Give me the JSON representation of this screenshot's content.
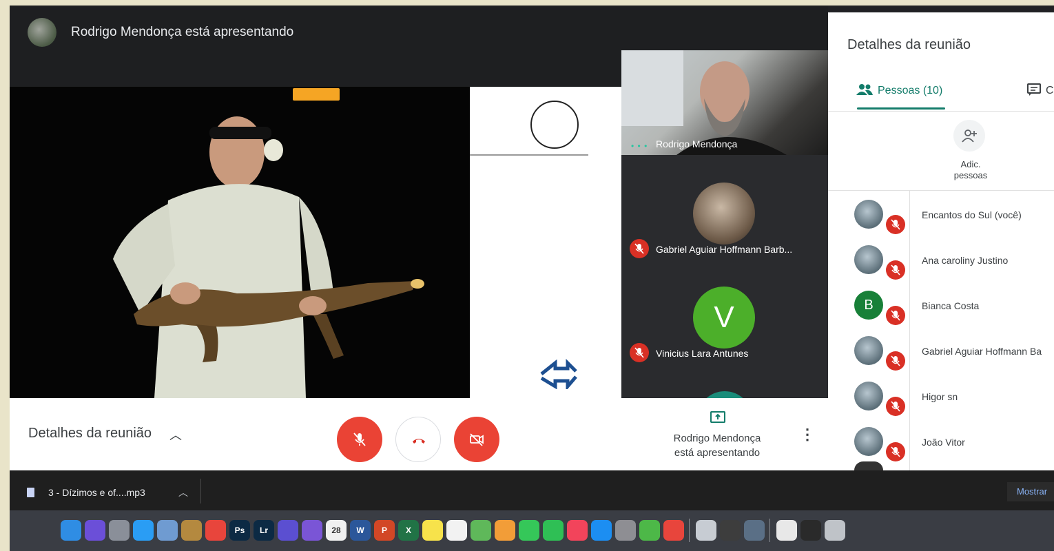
{
  "presenter_bar": {
    "text": "Rodrigo Mendonça está apresentando"
  },
  "tiles": [
    {
      "name": "Rodrigo Mendonça",
      "speaking": true
    },
    {
      "name": "Gabriel Aguiar Hoffmann Barb...",
      "muted": true
    },
    {
      "name": "Vinicius Lara Antunes",
      "avatar_letter": "V",
      "muted": true
    }
  ],
  "controls": {
    "details_label": "Detalhes da reunião",
    "presenting_text": [
      "Rodrigo Mendonça",
      "está apresentando"
    ]
  },
  "panel": {
    "title": "Detalhes da reunião",
    "tab_people": "Pessoas (10)",
    "tab_chat": "C",
    "add_people": [
      "Adic.",
      "pessoas"
    ],
    "people": [
      {
        "name": "Encantos do Sul (você)",
        "muted": true
      },
      {
        "name": "Ana caroliny Justino",
        "muted": true
      },
      {
        "name": "Bianca Costa",
        "avatar_letter": "B",
        "muted": true
      },
      {
        "name": "Gabriel Aguiar Hoffmann Ba",
        "muted": true
      },
      {
        "name": "Higor sn",
        "muted": true
      },
      {
        "name": "João Vitor",
        "muted": true
      }
    ]
  },
  "download_bar": {
    "file": "3 - Dízimos e of....mp3",
    "show_all": "Mostrar"
  },
  "dock": {
    "items": [
      {
        "icon": "finder-icon",
        "label": "",
        "color": "#2f8de4"
      },
      {
        "icon": "siri-icon",
        "label": "",
        "color": "#6b4fd8"
      },
      {
        "icon": "launchpad-icon",
        "label": "",
        "color": "#8a8f99"
      },
      {
        "icon": "safari-icon",
        "label": "",
        "color": "#2a9df4"
      },
      {
        "icon": "preview-icon",
        "label": "",
        "color": "#6f9bd1"
      },
      {
        "icon": "notes-book-icon",
        "label": "",
        "color": "#b4893f"
      },
      {
        "icon": "chrome-icon",
        "label": "",
        "color": "#e8453c"
      },
      {
        "icon": "photoshop-icon",
        "label": "Ps",
        "color": "#0c2a44"
      },
      {
        "icon": "lightroom-icon",
        "label": "Lr",
        "color": "#0c2a44"
      },
      {
        "icon": "imovie-icon",
        "label": "",
        "color": "#5b4fd1"
      },
      {
        "icon": "star-icon",
        "label": "",
        "color": "#7a55d6"
      },
      {
        "icon": "calendar-icon",
        "label": "28",
        "color": "#f0f0f0"
      },
      {
        "icon": "word-icon",
        "label": "W",
        "color": "#2b579a"
      },
      {
        "icon": "powerpoint-icon",
        "label": "P",
        "color": "#d24726"
      },
      {
        "icon": "excel-icon",
        "label": "X",
        "color": "#217346"
      },
      {
        "icon": "stickies-icon",
        "label": "",
        "color": "#f7e24b"
      },
      {
        "icon": "reminders-icon",
        "label": "",
        "color": "#f2f2f2"
      },
      {
        "icon": "maps-icon",
        "label": "",
        "color": "#5fb85a"
      },
      {
        "icon": "photos-icon",
        "label": "",
        "color": "#f29d38"
      },
      {
        "icon": "messages-icon",
        "label": "",
        "color": "#35c759"
      },
      {
        "icon": "facetime-icon",
        "label": "",
        "color": "#2fbf55"
      },
      {
        "icon": "music-icon",
        "label": "",
        "color": "#f2445b"
      },
      {
        "icon": "appstore-icon",
        "label": "",
        "color": "#1c8ef2"
      },
      {
        "icon": "settings-icon",
        "label": "",
        "color": "#8e8e93"
      },
      {
        "icon": "utorrent-icon",
        "label": "",
        "color": "#4db848"
      },
      {
        "icon": "anydesk-icon",
        "label": "",
        "color": "#e8453c"
      },
      {
        "icon": "mail-icon",
        "label": "",
        "color": "#c7ccd3"
      },
      {
        "icon": "books-icon",
        "label": "",
        "color": "#3d3d3d"
      },
      {
        "icon": "quicktime-icon",
        "label": "",
        "color": "#5a6f86"
      },
      {
        "icon": "document-icon",
        "label": "",
        "color": "#e8e8e8"
      },
      {
        "icon": "terminal-icon",
        "label": "",
        "color": "#2a2a2a"
      },
      {
        "icon": "trash-icon",
        "label": "",
        "color": "#bfc3c8"
      }
    ]
  }
}
